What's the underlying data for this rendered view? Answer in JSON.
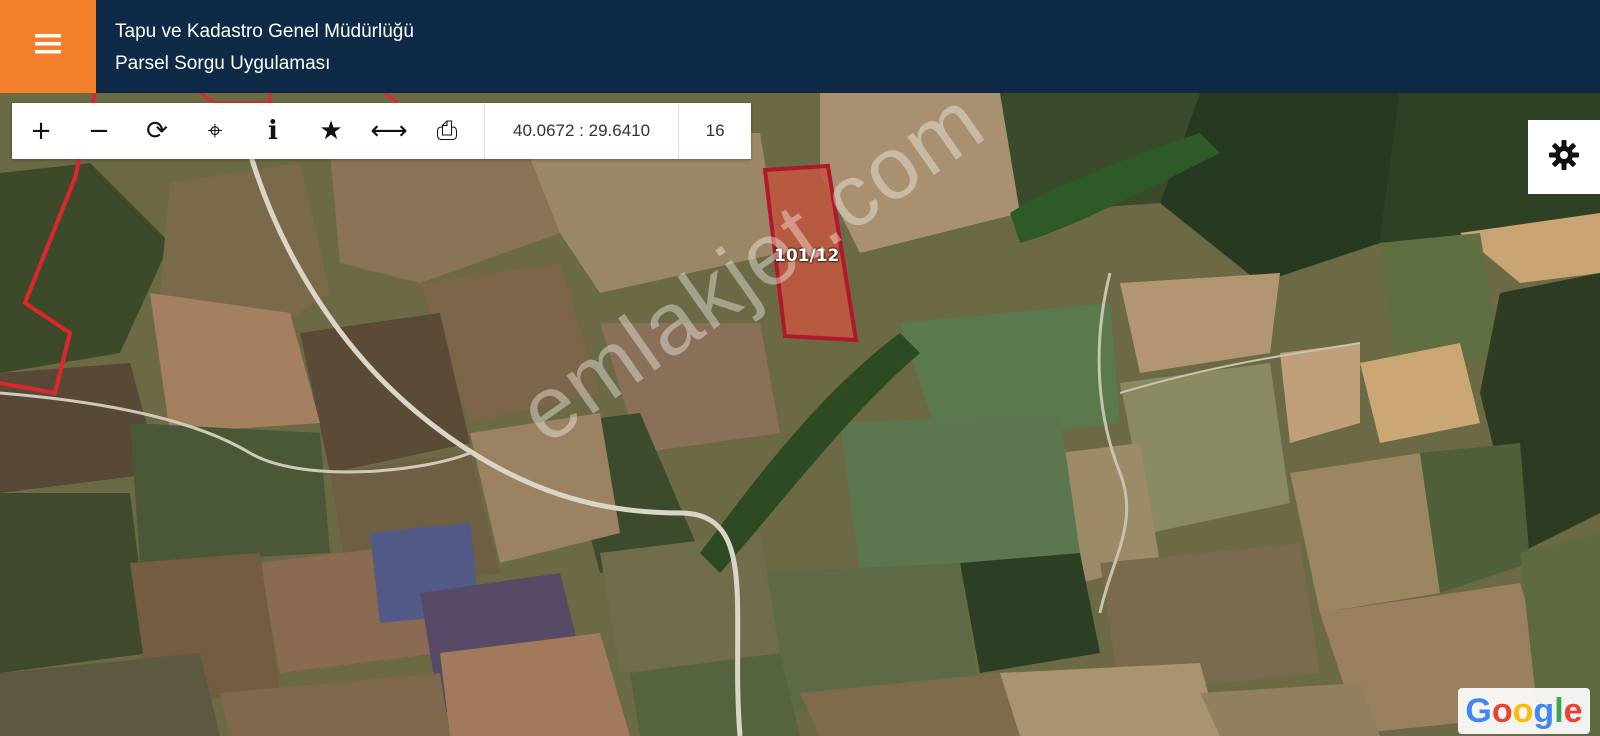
{
  "header": {
    "menu_icon": "hamburger-menu-icon",
    "title": "Tapu ve Kadastro Genel Müdürlüğü",
    "subtitle": "Parsel Sorgu Uygulaması",
    "bg_color": "#0f2a47",
    "menu_color": "#f47f2a"
  },
  "toolbar": {
    "tools": [
      {
        "icon": "zoom-in-icon",
        "glyph": "+"
      },
      {
        "icon": "zoom-out-icon",
        "glyph": "−"
      },
      {
        "icon": "refresh-icon",
        "glyph": "⟳"
      },
      {
        "icon": "locate-icon",
        "glyph": "⌖"
      },
      {
        "icon": "info-icon",
        "glyph": "i"
      },
      {
        "icon": "star-icon",
        "glyph": "★"
      },
      {
        "icon": "measure-icon",
        "glyph": "⟷"
      },
      {
        "icon": "print-icon",
        "glyph": "⎙"
      }
    ],
    "coordinates": "40.0672 : 29.6410",
    "zoom_level": "16"
  },
  "map": {
    "parcel_label": "101/12",
    "parcel_color": "#b0182b",
    "watermark": "emlakjet.com",
    "attribution": "Google",
    "settings_icon": "gear-icon"
  }
}
